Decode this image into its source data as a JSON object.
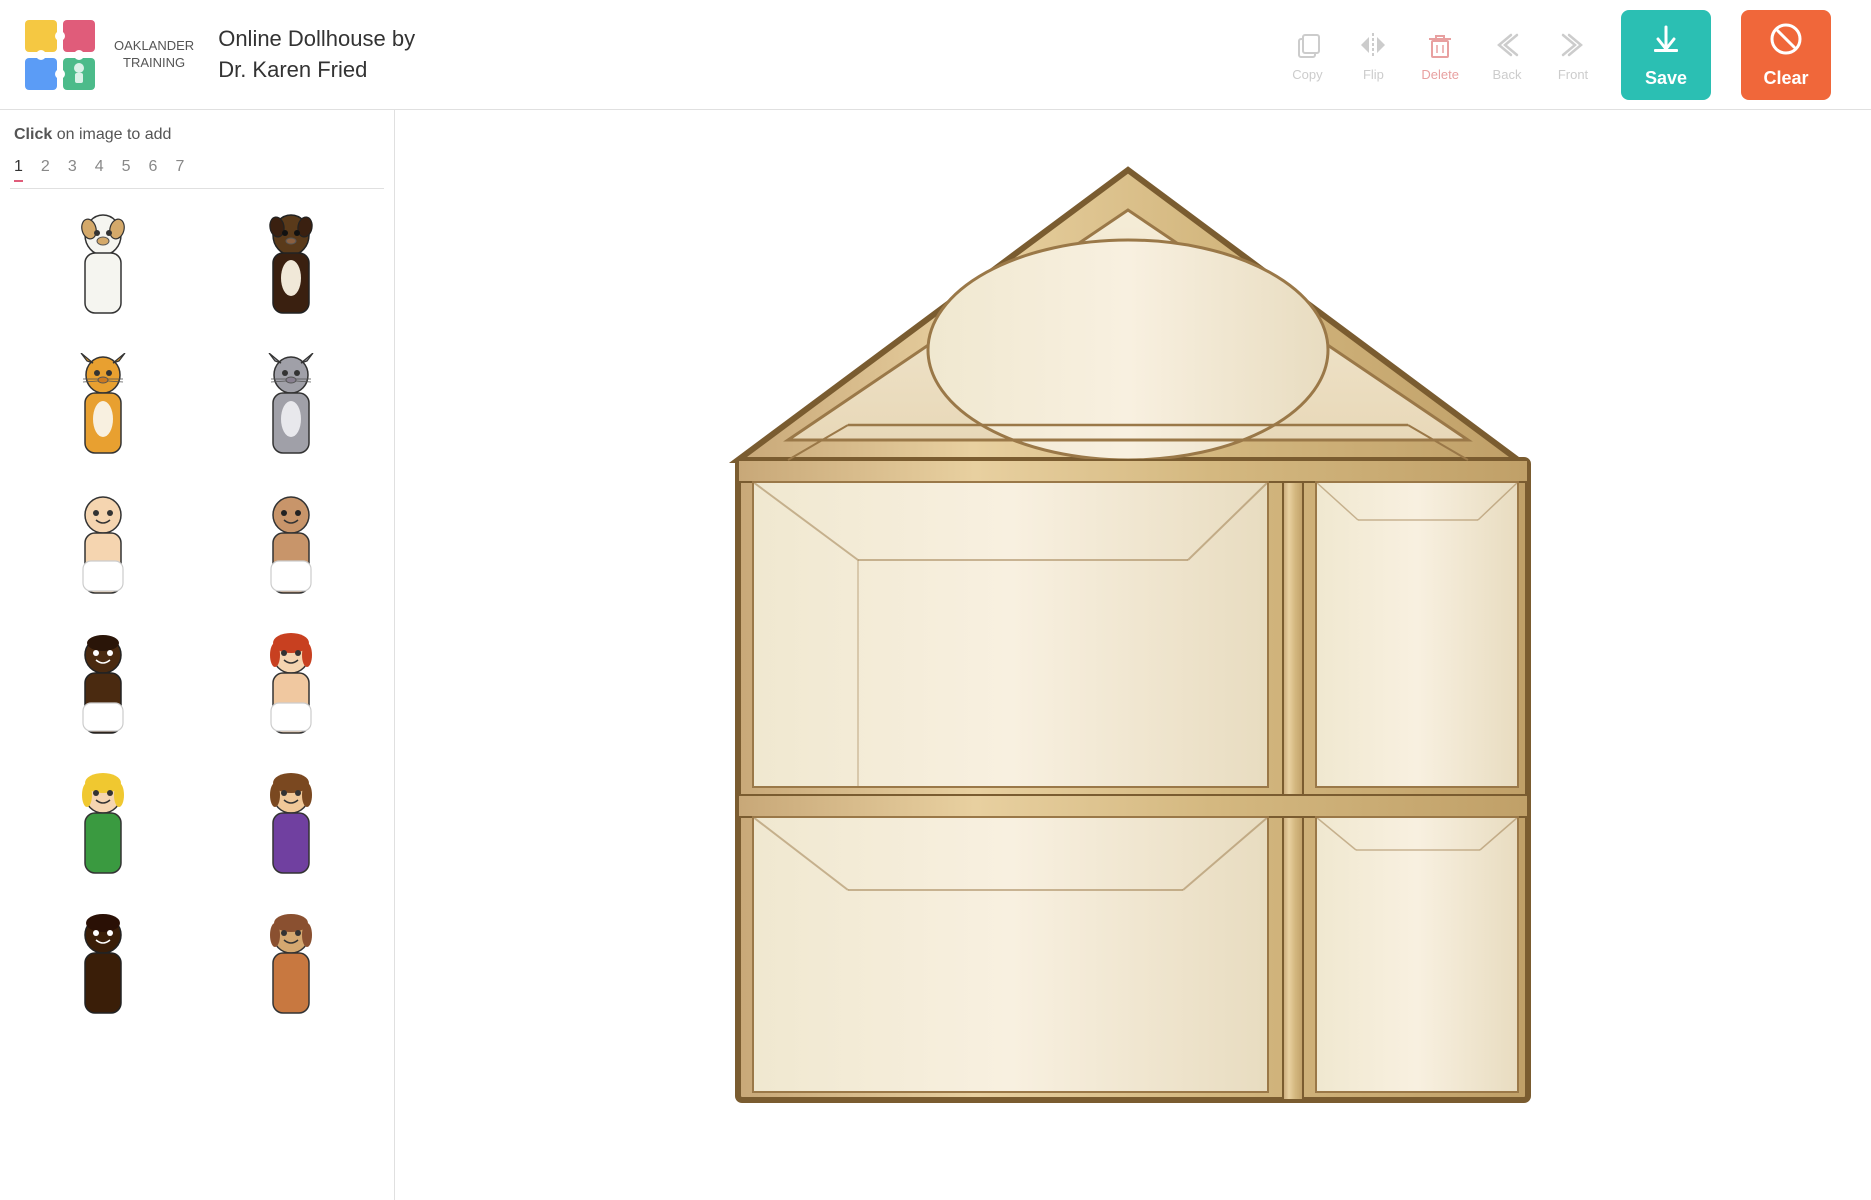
{
  "header": {
    "app_title_line1": "Online Dollhouse by",
    "app_title_line2": "Dr. Karen Fried",
    "logo_text_line1": "OAKLANDER",
    "logo_text_line2": "TRAINING",
    "toolbar": {
      "copy_label": "Copy",
      "flip_label": "Flip",
      "delete_label": "Delete",
      "back_label": "Back",
      "front_label": "Front",
      "save_label": "Save",
      "clear_label": "Clear"
    }
  },
  "sidebar": {
    "instruction": "Click",
    "instruction_rest": " on image to add",
    "tabs": [
      "1",
      "2",
      "3",
      "4",
      "5",
      "6",
      "7"
    ],
    "active_tab": "1"
  },
  "colors": {
    "save_bg": "#2bbfb3",
    "clear_bg": "#f0673a",
    "active_tab_line": "#e05c7a"
  }
}
